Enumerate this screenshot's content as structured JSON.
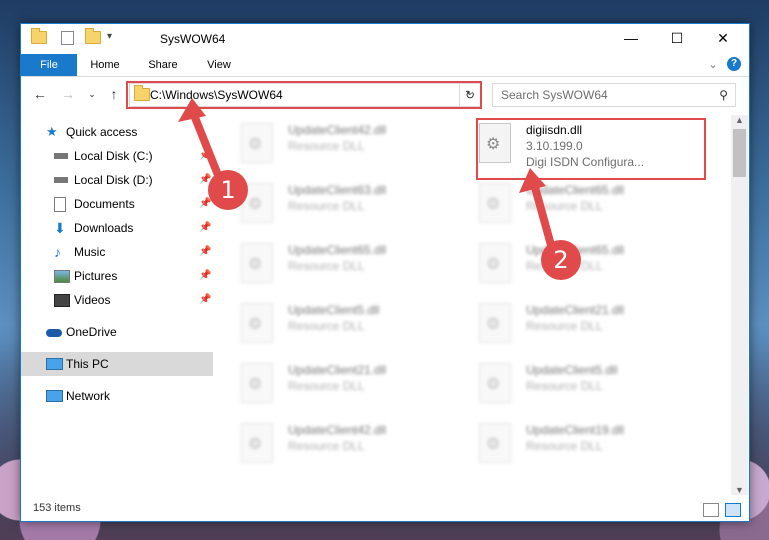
{
  "window": {
    "title": "SysWOW64",
    "controls": {
      "minimize": "—",
      "maximize": "☐",
      "close": "✕"
    }
  },
  "ribbon": {
    "tabs": [
      "File",
      "Home",
      "Share",
      "View"
    ]
  },
  "address_bar": {
    "path": "C:\\Windows\\SysWOW64",
    "refresh_icon": "↻"
  },
  "search": {
    "placeholder": "Search SysWOW64"
  },
  "sidebar": {
    "items": [
      {
        "label": "Quick access",
        "icon": "star-icon",
        "pinned": false
      },
      {
        "label": "Local Disk (C:)",
        "icon": "drive-icon",
        "pinned": true
      },
      {
        "label": "Local Disk (D:)",
        "icon": "drive-icon",
        "pinned": true
      },
      {
        "label": "Documents",
        "icon": "documents-icon",
        "pinned": true
      },
      {
        "label": "Downloads",
        "icon": "downloads-icon",
        "pinned": true
      },
      {
        "label": "Music",
        "icon": "music-icon",
        "pinned": true
      },
      {
        "label": "Pictures",
        "icon": "pictures-icon",
        "pinned": true
      },
      {
        "label": "Videos",
        "icon": "videos-icon",
        "pinned": true
      },
      {
        "label": "OneDrive",
        "icon": "onedrive-icon",
        "pinned": false
      },
      {
        "label": "This PC",
        "icon": "pc-icon",
        "pinned": false,
        "selected": true
      },
      {
        "label": "Network",
        "icon": "network-icon",
        "pinned": false
      }
    ]
  },
  "files": {
    "left_column": [
      {
        "name": "UpdateClient42.dll",
        "type": "Resource DLL"
      },
      {
        "name": "UpdateClient63.dll",
        "type": "Resource DLL"
      },
      {
        "name": "UpdateClient65.dll",
        "type": "Resource DLL"
      },
      {
        "name": "UpdateClient5.dll",
        "type": "Resource DLL"
      },
      {
        "name": "UpdateClient21.dll",
        "type": "Resource DLL"
      },
      {
        "name": "UpdateClient42.dll",
        "type": "Resource DLL"
      }
    ],
    "right_column": [
      {
        "name": "UpdateClient65.dll",
        "type": "Resource DLL"
      },
      {
        "name": "UpdateClient65.dll",
        "type": "Resource DLL"
      },
      {
        "name": "UpdateClient21.dll",
        "type": "Resource DLL"
      },
      {
        "name": "UpdateClient5.dll",
        "type": "Resource DLL"
      },
      {
        "name": "UpdateClient19.dll",
        "type": "Resource DLL"
      }
    ],
    "highlighted": {
      "name": "digiisdn.dll",
      "version": "3.10.199.0",
      "description": "Digi ISDN Configura..."
    }
  },
  "status": {
    "item_count": "153 items"
  },
  "annotations": {
    "badge_1": "1",
    "badge_2": "2",
    "color": "#e04a4a"
  }
}
